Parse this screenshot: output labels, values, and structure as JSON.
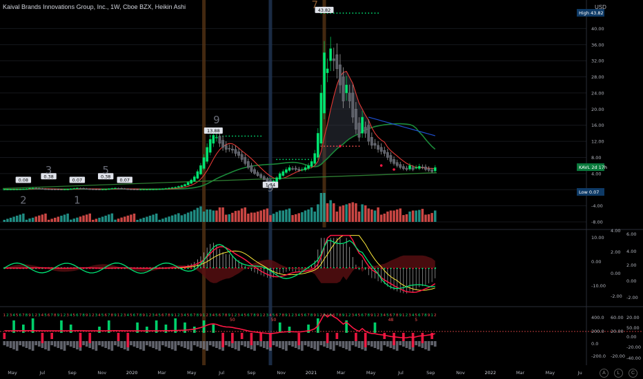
{
  "header": {
    "title": "Kaival Brands Innovations Group, Inc., 1W, Cboe BZX, Heikin Ashi",
    "currency": "USD"
  },
  "badges": {
    "high": {
      "label": "High",
      "value": "43.82",
      "color": "#0e3a66"
    },
    "low": {
      "label": "Low",
      "value": "0.07",
      "color": "#0e3a66"
    },
    "ticker": {
      "label": "KAVL",
      "countdown": "2d 17h",
      "color": "#0a7a3c"
    }
  },
  "annotations": {
    "peak": "43.82",
    "swing_high": "13.88",
    "swing_low": "1.74",
    "early_labels": [
      "0.08",
      "0.38",
      "0.07",
      "0.38",
      "0.07"
    ],
    "td_counts": [
      "2",
      "3",
      "1",
      "5",
      "9",
      "9",
      "7"
    ],
    "bottom_counts": [
      "50",
      "50",
      "48",
      "5"
    ]
  },
  "icons": [
    "A",
    "L",
    "C"
  ],
  "chart_data": [
    {
      "type": "candlestick",
      "name": "price",
      "ylim": [
        -8,
        44
      ],
      "yticks": [
        "40.00",
        "36.00",
        "32.00",
        "28.00",
        "24.00",
        "20.00",
        "16.00",
        "12.00",
        "8.00",
        "4.00",
        "0.00",
        "-4.00",
        "-8.00"
      ],
      "ytick_values": [
        40,
        36,
        32,
        28,
        24,
        20,
        16,
        12,
        8,
        4,
        0,
        -4,
        -8
      ],
      "xticks": [
        "May",
        "Jul",
        "Sep",
        "Nov",
        "2020",
        "Mar",
        "May",
        "Jul",
        "Sep",
        "Nov",
        "2021",
        "Mar",
        "May",
        "Jul",
        "Sep",
        "Nov",
        "2022",
        "Mar",
        "May",
        "Ju"
      ],
      "closes": [
        0.08,
        0.08,
        0.08,
        0.09,
        0.1,
        0.12,
        0.15,
        0.2,
        0.35,
        0.38,
        0.3,
        0.2,
        0.15,
        0.12,
        0.1,
        0.09,
        0.08,
        0.07,
        0.07,
        0.08,
        0.1,
        0.2,
        0.3,
        0.38,
        0.3,
        0.2,
        0.15,
        0.1,
        0.08,
        0.07,
        0.07,
        0.08,
        0.1,
        0.2,
        0.3,
        0.38,
        0.3,
        0.2,
        0.15,
        0.1,
        0.08,
        0.07,
        0.07,
        0.07,
        0.08,
        0.08,
        0.09,
        0.1,
        0.12,
        0.15,
        0.2,
        0.3,
        0.4,
        0.5,
        0.6,
        0.8,
        1.0,
        1.3,
        1.8,
        2.4,
        3.2,
        4.5,
        6.0,
        8.0,
        10.5,
        12.5,
        13.5,
        13.0,
        11.5,
        10.5,
        10.0,
        10.2,
        9.8,
        9.0,
        8.5,
        7.5,
        6.5,
        5.5,
        4.5,
        4.0,
        3.5,
        3.0,
        2.5,
        2.0,
        1.74,
        2.2,
        3.0,
        4.0,
        4.5,
        5.0,
        5.5,
        5.2,
        5.0,
        4.8,
        5.0,
        5.5,
        6.0,
        7.0,
        9.0,
        14.0,
        24.0,
        34.0,
        30.0,
        35.0,
        32.0,
        30.0,
        26.0,
        22.0,
        26.0,
        22.0,
        18.0,
        15.0,
        13.0,
        18.0,
        14.0,
        12.0,
        11.0,
        11.0,
        10.0,
        9.5,
        9.0,
        8.0,
        7.0,
        6.5,
        6.0,
        5.5,
        5.2,
        5.0,
        6.0,
        5.0,
        5.5,
        5.8,
        5.5,
        5.0,
        4.8,
        4.5,
        5.5
      ],
      "overlays": {
        "upper_dots": {
          "level": 43.82,
          "color": "#00e676"
        },
        "mid_dots": {
          "level": 13.3,
          "color": "#00e676"
        },
        "support_dots": {
          "level": 7.5,
          "color": "#00e676"
        },
        "red_dots": {
          "level": 10.8,
          "color": "#ff5252"
        }
      }
    },
    {
      "type": "bar",
      "name": "volume",
      "colors": [
        "#26a69a",
        "#ef5350"
      ]
    },
    {
      "type": "line",
      "name": "oscillator",
      "ylim": [
        -14,
        14
      ],
      "yticks_right1": [
        "10.00",
        "0.00",
        "-10.00"
      ],
      "ytick_values_right1": [
        10,
        0,
        -10
      ],
      "yticks_right2": [
        "4.00",
        "2.00",
        "0.00",
        "-2.00"
      ],
      "yticks_right3": [
        "6.00",
        "4.00",
        "2.00",
        "0.00",
        "-2.00"
      ]
    },
    {
      "type": "bar",
      "name": "momentum",
      "yticks_right1": [
        "400.0",
        "200.0",
        "0.0",
        "-200.0"
      ],
      "yticks_right2": [
        "60.00",
        "20.00",
        "-20.00"
      ],
      "yticks_right3": [
        "20.00",
        "50.00",
        "0.00",
        "-20.00",
        "-40.00"
      ]
    }
  ]
}
